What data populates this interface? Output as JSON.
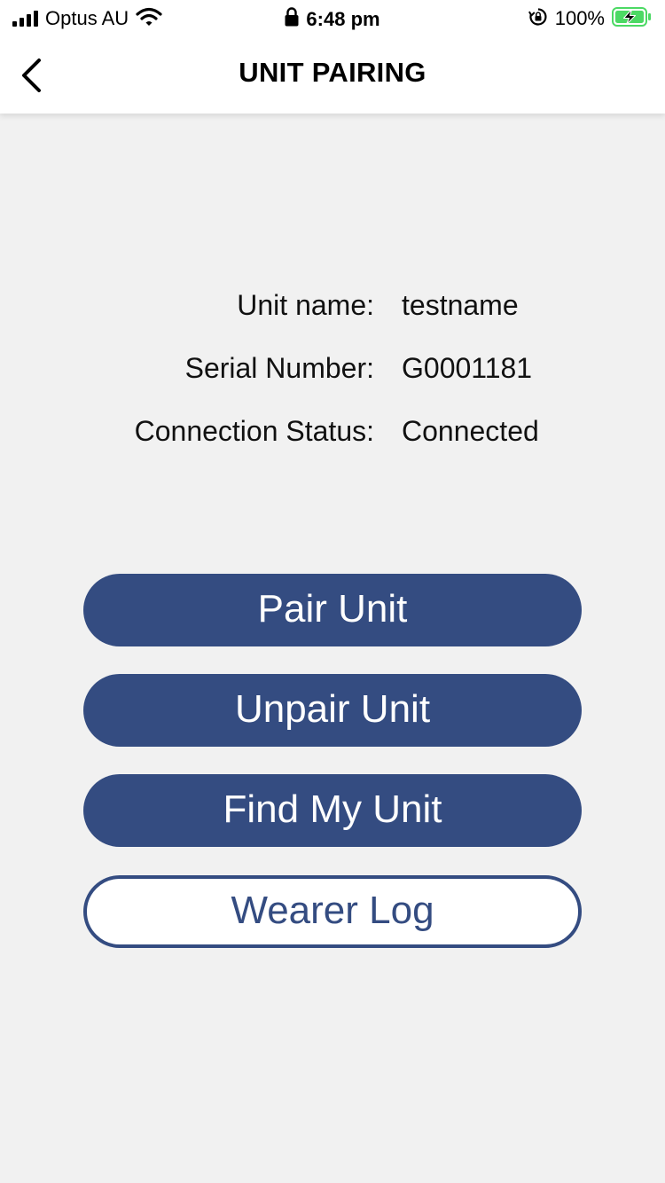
{
  "status_bar": {
    "carrier": "Optus AU",
    "time": "6:48 pm",
    "battery_percent": "100%"
  },
  "nav": {
    "title": "UNIT PAIRING"
  },
  "unit_info": [
    {
      "label": "Unit name:",
      "value": "testname"
    },
    {
      "label": "Serial Number:",
      "value": "G0001181"
    },
    {
      "label": "Connection Status:",
      "value": "Connected"
    }
  ],
  "buttons": {
    "pair": "Pair Unit",
    "unpair": "Unpair Unit",
    "find": "Find My Unit",
    "wearer_log": "Wearer Log"
  },
  "icons": {
    "status": [
      "signal-bars-icon",
      "wifi-icon",
      "lock-icon",
      "orientation-lock-icon",
      "battery-charging-icon"
    ],
    "nav": [
      "back-chevron-icon"
    ]
  },
  "colors": {
    "primary": "#344c81",
    "battery_fill": "#4cd964",
    "background": "#f1f1f1"
  }
}
